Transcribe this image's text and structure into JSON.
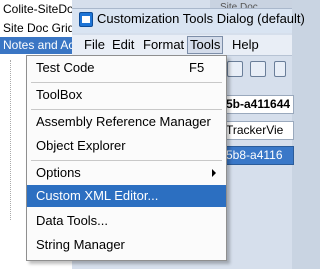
{
  "background": {
    "left_items": [
      "Colite-SiteDoc",
      "Site Doc Grid",
      "Notes and Act"
    ],
    "top_tab": "Site Doc",
    "right_fields": [
      "5b-a411644",
      "TrackerVie",
      "5b8-a4116"
    ]
  },
  "dialog": {
    "title": "Customization Tools Dialog (default)"
  },
  "menubar": {
    "items": [
      "File",
      "Edit",
      "Format",
      "Tools",
      "Help"
    ]
  },
  "tools_menu": {
    "items": [
      {
        "label": "Test Code",
        "shortcut": "F5"
      },
      {
        "label": "ToolBox"
      },
      {
        "label": "Assembly Reference Manager"
      },
      {
        "label": "Object Explorer"
      },
      {
        "label": "Options"
      },
      {
        "label": "Custom XML Editor..."
      },
      {
        "label": "Data Tools..."
      },
      {
        "label": "String Manager"
      }
    ]
  },
  "colors": {
    "highlight": "#2c6fc1",
    "selected_row": "#3a76c4"
  }
}
